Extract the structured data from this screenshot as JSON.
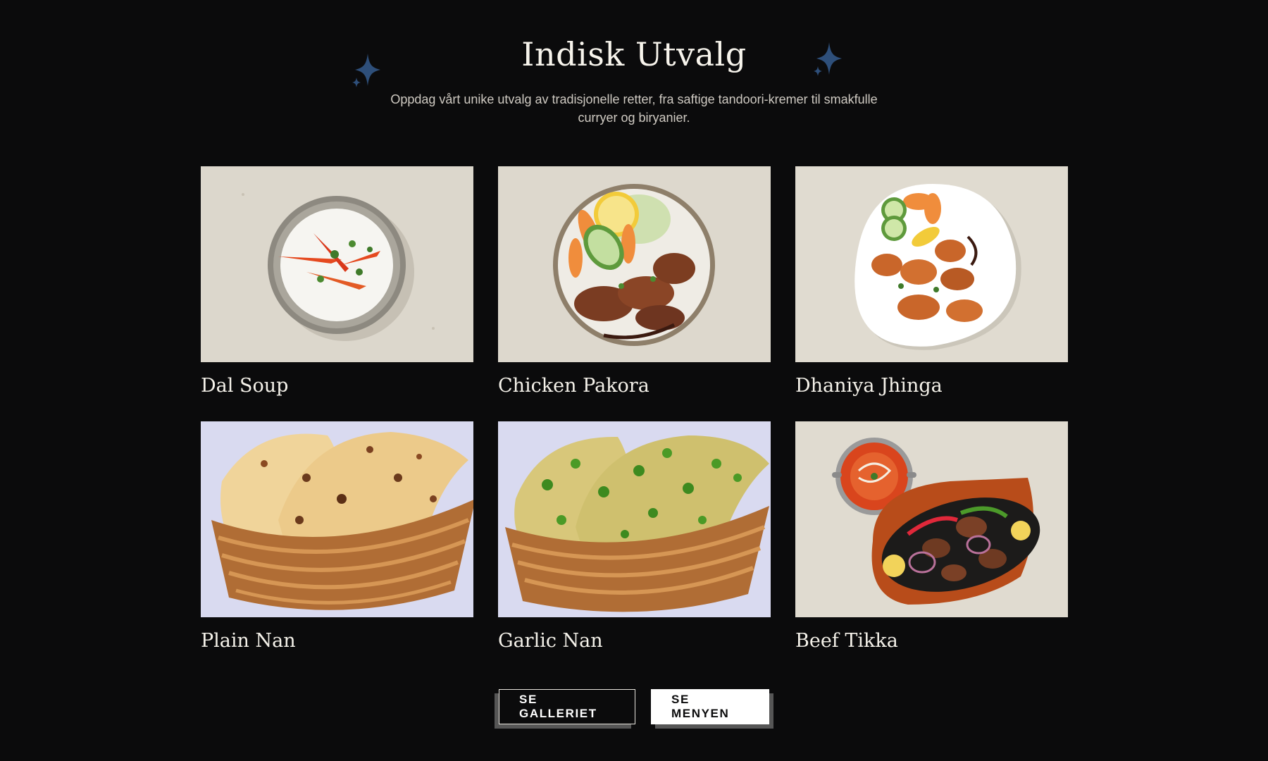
{
  "header": {
    "title": "Indisk Utvalg",
    "subtitle": "Oppdag vårt unike utvalg av tradisjonelle retter, fra saftige tandoori-kremer til smakfulle curryer og biryanier.",
    "sparkle_color": "#2e4f7a"
  },
  "dishes": [
    {
      "name": "Dal Soup",
      "icon": "bowl-of-yogurt-soup-photo"
    },
    {
      "name": "Chicken Pakora",
      "icon": "plate-of-pakora-photo"
    },
    {
      "name": "Dhaniya Jhinga",
      "icon": "plate-of-shrimp-photo"
    },
    {
      "name": "Plain Nan",
      "icon": "basket-of-naan-photo"
    },
    {
      "name": "Garlic Nan",
      "icon": "basket-of-garlic-naan-photo"
    },
    {
      "name": "Beef Tikka",
      "icon": "sizzling-platter-photo"
    }
  ],
  "actions": {
    "gallery_label": "SE GALLERIET",
    "menu_label": "SE MENYEN"
  },
  "colors": {
    "background": "#0b0b0c",
    "text": "#f4f1ea",
    "button_shadow": "#565656"
  }
}
